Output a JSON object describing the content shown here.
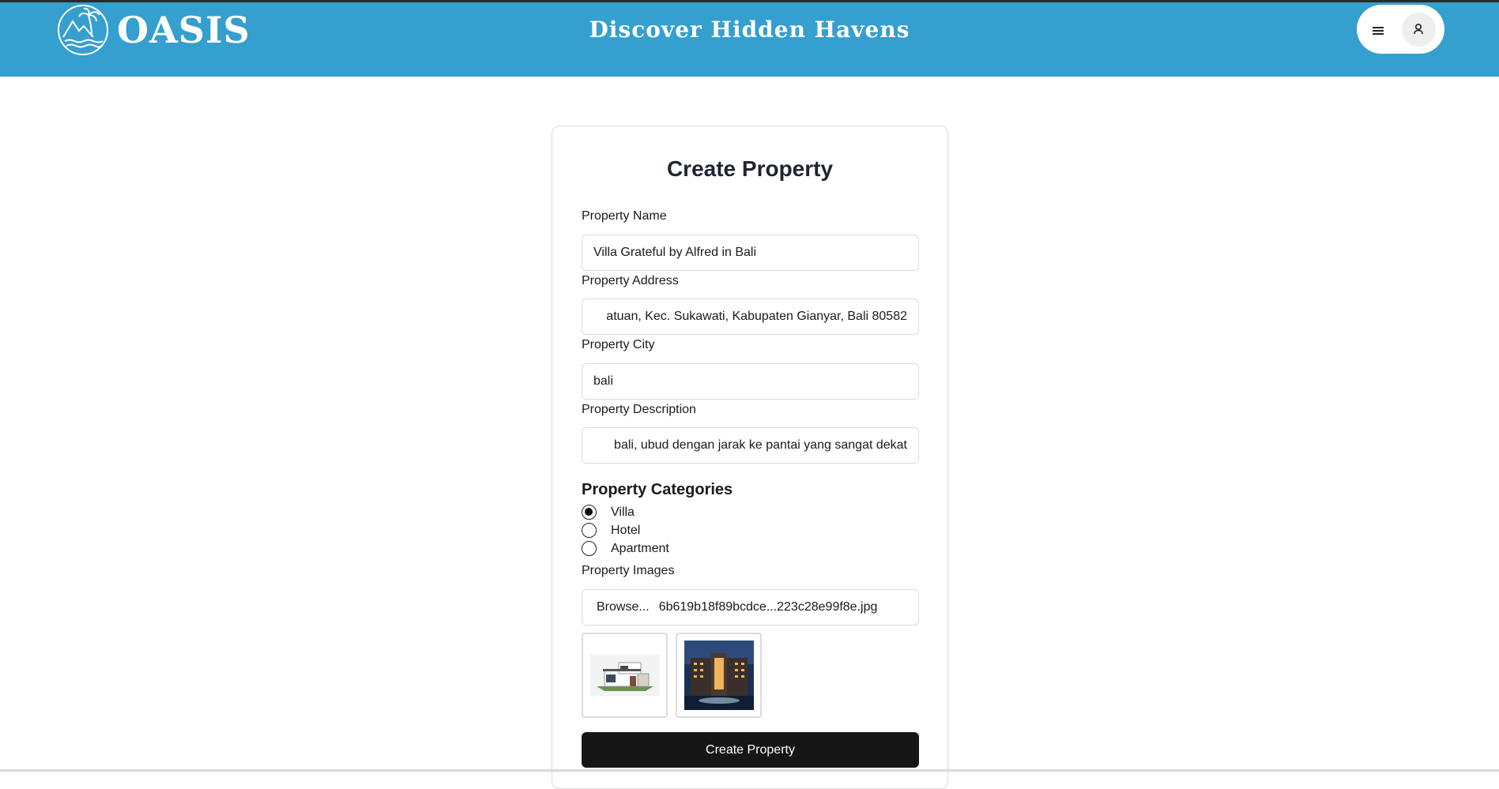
{
  "header": {
    "brand": "OASIS",
    "tagline": "Discover Hidden Havens",
    "icons": [
      "logo-icon",
      "menu-icon",
      "user-icon"
    ]
  },
  "form": {
    "title": "Create Property",
    "fields": {
      "name": {
        "label": "Property Name",
        "value": "Villa Grateful by Alfred in Bali"
      },
      "address": {
        "label": "Property Address",
        "value": "atuan, Kec. Sukawati, Kabupaten Gianyar, Bali 80582"
      },
      "city": {
        "label": "Property City",
        "value": "bali"
      },
      "description": {
        "label": "Property Description",
        "value": "bali, ubud dengan jarak ke pantai yang sangat dekat"
      }
    },
    "categories": {
      "title": "Property Categories",
      "options": [
        {
          "label": "Villa",
          "checked": true
        },
        {
          "label": "Hotel",
          "checked": false
        },
        {
          "label": "Apartment",
          "checked": false
        }
      ]
    },
    "images": {
      "label": "Property Images",
      "browse_label": "Browse...",
      "file_name": "6b619b18f89bcdce...223c28e99f8e.jpg",
      "thumbnails": [
        "modern-villa-image",
        "hotel-night-image"
      ]
    },
    "submit_label": "Create Property"
  },
  "colors": {
    "header": "#359fcf",
    "button": "#161616"
  }
}
